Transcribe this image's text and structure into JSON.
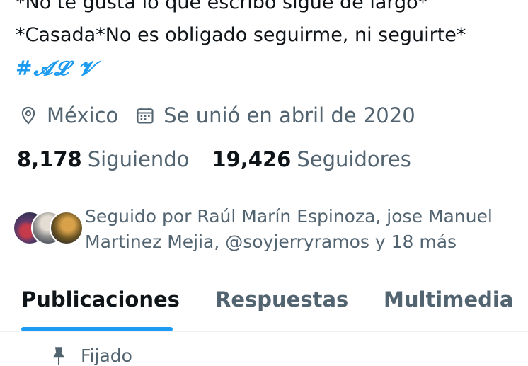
{
  "profile": {
    "bio_line1": "*No te gusta lo que escribo sigue de largo*",
    "bio_line2": "*Casada*No es obligado seguirme, ni seguirte*",
    "hashtag": "#𝓐𝓛 𝓥",
    "location": "México",
    "joined": "Se unió en abril de 2020",
    "following_count": "8,178",
    "following_label": "Siguiendo",
    "followers_count": "19,426",
    "followers_label": "Seguidores",
    "followed_by_line1": "Seguido por Raúl Marín Espinoza, jose Manuel",
    "followed_by_line2": "Martinez Mejia, @soyjerryramos y 18 más"
  },
  "tabs": [
    {
      "label": "Publicaciones",
      "active": true
    },
    {
      "label": "Respuestas",
      "active": false
    },
    {
      "label": "Multimedia",
      "active": false
    }
  ],
  "pinned": {
    "label": "Fijado"
  },
  "icons": {
    "location": "location-pin-icon",
    "calendar": "calendar-icon",
    "pin": "pin-icon"
  },
  "colors": {
    "accent": "#1d9bf0",
    "text_primary": "#0f1419",
    "text_secondary": "#536471"
  }
}
